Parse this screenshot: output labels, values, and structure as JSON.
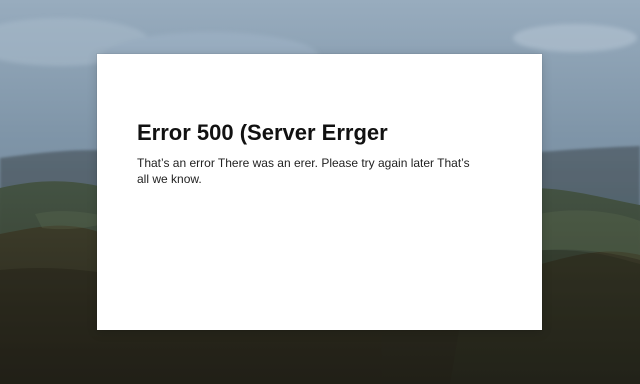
{
  "colors": {
    "card_background": "#ffffff",
    "title_text": "#111111",
    "message_text": "#222222"
  },
  "error": {
    "title": "Error 500 (Server Errger",
    "message": "That’s an error There was an erer. Please try again later That’s all we know."
  }
}
